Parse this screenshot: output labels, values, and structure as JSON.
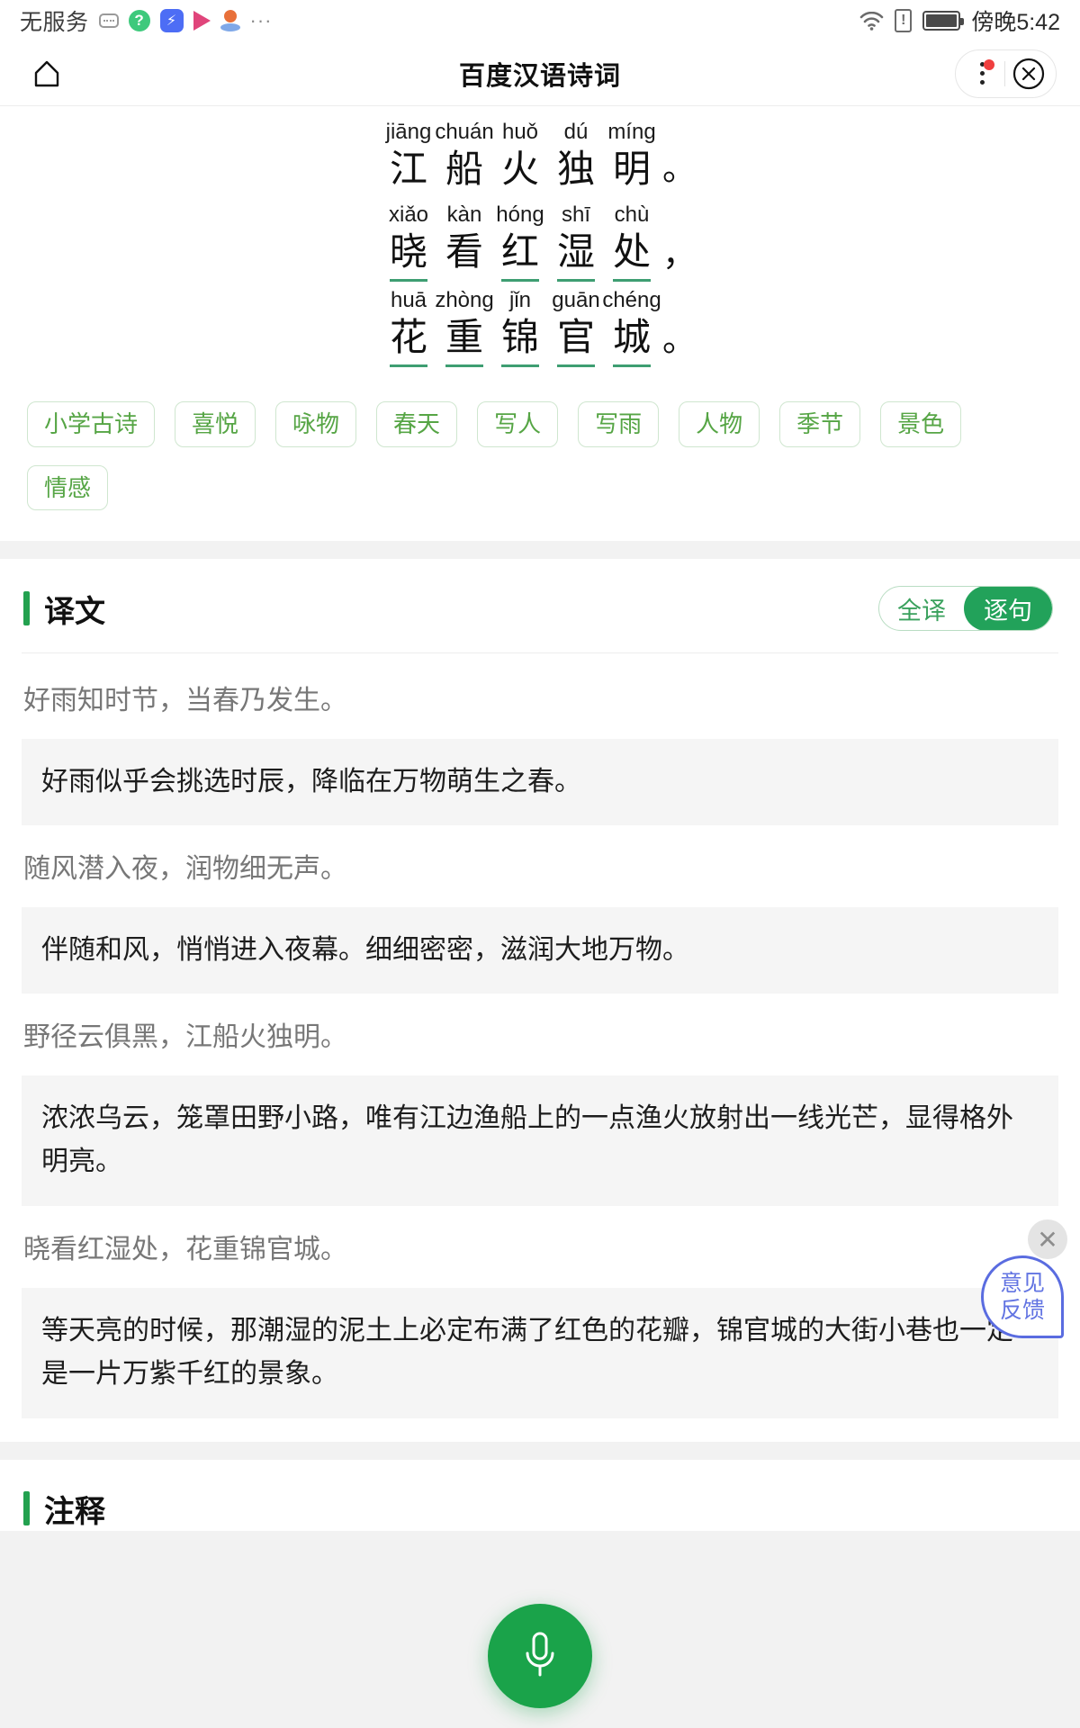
{
  "statusbar": {
    "carrier": "无服务",
    "time": "傍晚5:42",
    "left_icons": [
      "sms-icon",
      "qq-browser-icon",
      "lightning-icon",
      "video-play-icon",
      "location-pin-icon",
      "overflow-dots-icon"
    ],
    "right_icons": [
      "wifi-icon",
      "sim-alert-icon",
      "battery-icon"
    ],
    "sim_glyph": "!",
    "dots_glyph": "···"
  },
  "header": {
    "title": "百度汉语诗词",
    "home_icon": "home-icon",
    "menu_icon": "more-vertical-icon",
    "close_icon": "close-circle-icon"
  },
  "poem": {
    "lines": [
      {
        "cells": [
          {
            "pinyin": "jiāng",
            "char": "江",
            "underline": false
          },
          {
            "pinyin": "chuán",
            "char": "船",
            "underline": false
          },
          {
            "pinyin": "huǒ",
            "char": "火",
            "underline": false
          },
          {
            "pinyin": "dú",
            "char": "独",
            "underline": false
          },
          {
            "pinyin": "míng",
            "char": "明",
            "underline": false
          }
        ],
        "punc": "。"
      },
      {
        "cells": [
          {
            "pinyin": "xiǎo",
            "char": "晓",
            "underline": true
          },
          {
            "pinyin": "kàn",
            "char": "看",
            "underline": false
          },
          {
            "pinyin": "hóng",
            "char": "红",
            "underline": true
          },
          {
            "pinyin": "shī",
            "char": "湿",
            "underline": true
          },
          {
            "pinyin": "chù",
            "char": "处",
            "underline": true
          }
        ],
        "punc": "，"
      },
      {
        "cells": [
          {
            "pinyin": "huā",
            "char": "花",
            "underline": true
          },
          {
            "pinyin": "zhòng",
            "char": "重",
            "underline": true
          },
          {
            "pinyin": "jǐn",
            "char": "锦",
            "underline": true
          },
          {
            "pinyin": "guān",
            "char": "官",
            "underline": true
          },
          {
            "pinyin": "chéng",
            "char": "城",
            "underline": true
          }
        ],
        "punc": "。"
      }
    ]
  },
  "tags": [
    "小学古诗",
    "喜悦",
    "咏物",
    "春天",
    "写人",
    "写雨",
    "人物",
    "季节",
    "景色",
    "情感"
  ],
  "translation_section": {
    "title": "译文",
    "toggle": {
      "inactive": "全译",
      "active": "逐句"
    },
    "items": [
      {
        "source": "好雨知时节，当春乃发生。",
        "translation": "好雨似乎会挑选时辰，降临在万物萌生之春。"
      },
      {
        "source": "随风潜入夜，润物细无声。",
        "translation": "伴随和风，悄悄进入夜幕。细细密密，滋润大地万物。"
      },
      {
        "source": "野径云俱黑，江船火独明。",
        "translation": "浓浓乌云，笼罩田野小路，唯有江边渔船上的一点渔火放射出一线光芒，显得格外明亮。"
      },
      {
        "source": "晓看红湿处，花重锦官城。",
        "translation": "等天亮的时候，那潮湿的泥土上必定布满了红色的花瓣，锦官城的大街小巷也一定是一片万紫千红的景象。"
      }
    ]
  },
  "notes_section": {
    "title": "注释"
  },
  "feedback": {
    "line1": "意见",
    "line2": "反馈",
    "close_glyph": "✕",
    "color": "#5a6ce0"
  },
  "mic": {
    "icon": "microphone-icon",
    "color": "#1aa34a"
  },
  "colors": {
    "accent_green": "#22a25a",
    "tag_green": "#56a545",
    "underline_green": "#3e9e72"
  }
}
